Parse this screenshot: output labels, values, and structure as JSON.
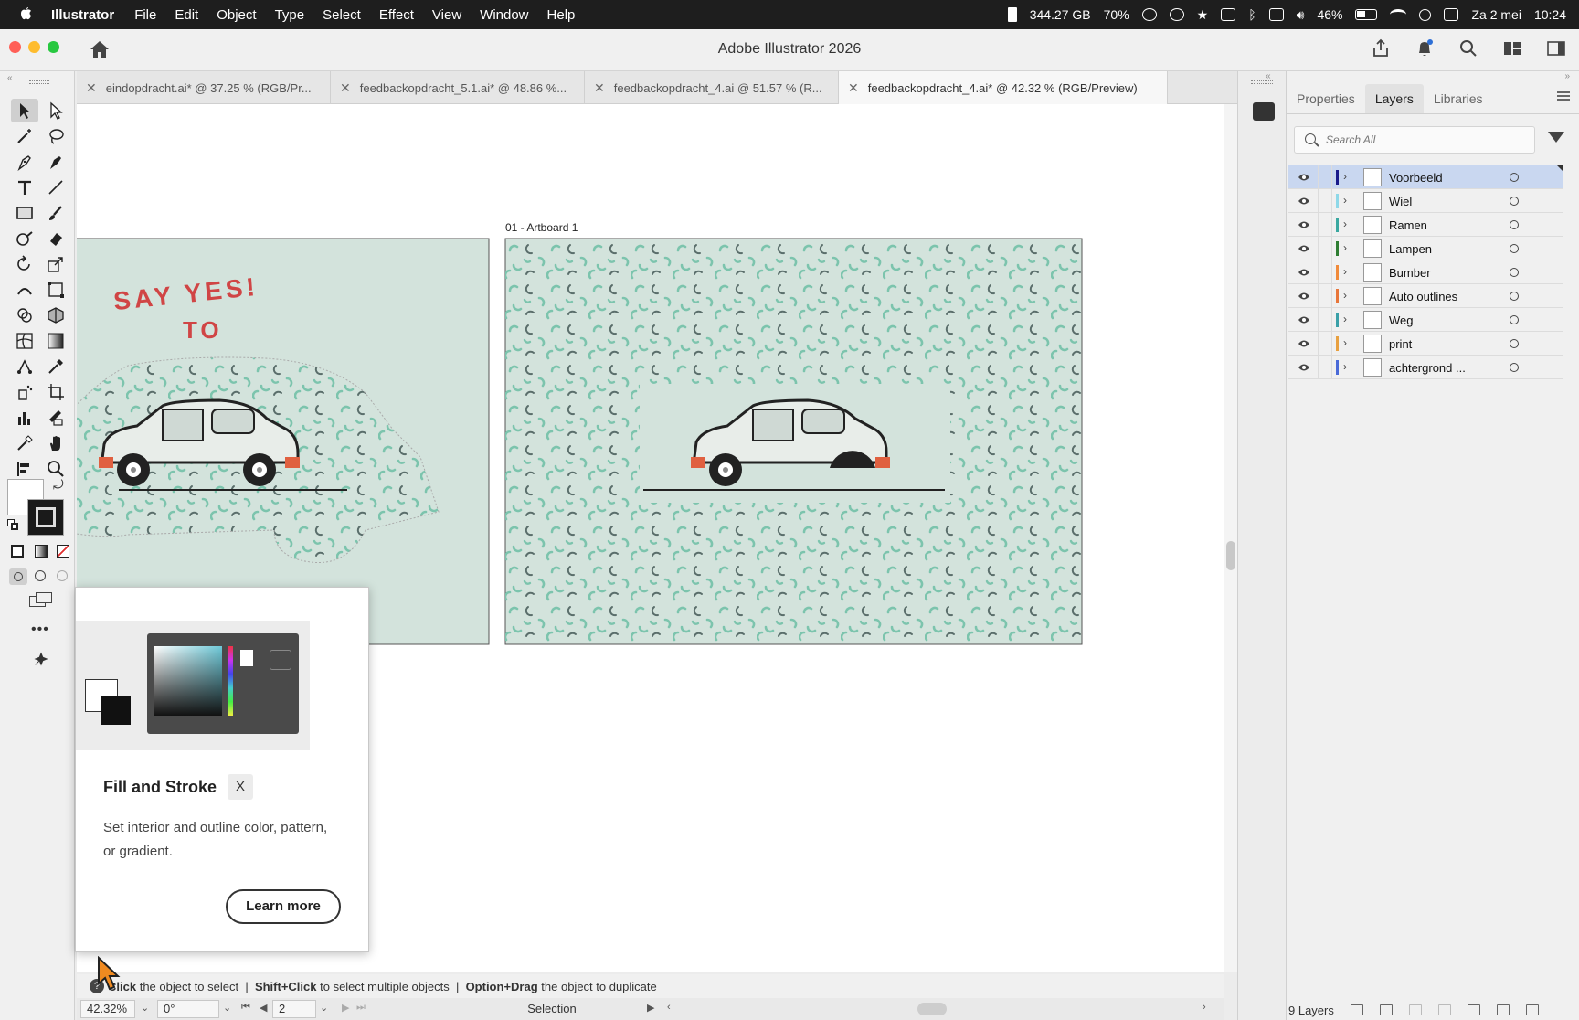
{
  "menubar": {
    "app": "Illustrator",
    "items": [
      "File",
      "Edit",
      "Object",
      "Type",
      "Select",
      "Effect",
      "View",
      "Window",
      "Help"
    ],
    "disk": "344.27 GB",
    "percent": "70%",
    "battery": "46%",
    "date": "Za 2 mei",
    "time": "10:24"
  },
  "window": {
    "title": "Adobe Illustrator 2026"
  },
  "tabs": [
    {
      "label": "eindopdracht.ai* @ 37.25 % (RGB/Pr..."
    },
    {
      "label": "feedbackopdracht_5.1.ai* @ 48.86 %..."
    },
    {
      "label": "feedbackopdracht_4.ai @ 51.57 % (R..."
    },
    {
      "label": "feedbackopdracht_4.ai* @ 42.32 % (RGB/Preview)"
    }
  ],
  "canvas": {
    "artboard_label": "01 - Artboard 1",
    "left_art_text_1": "SAY YES!",
    "left_art_text_2": "TO",
    "bg_color": "#d3e3dc",
    "pattern_colors": [
      "#7cc4ad",
      "#5a6e6b"
    ]
  },
  "right_panel": {
    "tabs": [
      "Properties",
      "Layers",
      "Libraries"
    ],
    "active_tab": "Layers",
    "search_placeholder": "Search All",
    "layers": [
      {
        "name": "Voorbeeld",
        "color": "#1a1a8a",
        "selected": true
      },
      {
        "name": "Wiel",
        "color": "#8ed8e8",
        "selected": false
      },
      {
        "name": "Ramen",
        "color": "#3aa8a0",
        "selected": false
      },
      {
        "name": "Lampen",
        "color": "#2e7d32",
        "selected": false
      },
      {
        "name": "Bumber",
        "color": "#f08a3a",
        "selected": false
      },
      {
        "name": "Auto outlines",
        "color": "#e8763a",
        "selected": false
      },
      {
        "name": "Weg",
        "color": "#3aa0a8",
        "selected": false
      },
      {
        "name": "print",
        "color": "#e8a040",
        "selected": false
      },
      {
        "name": "achtergrond ...",
        "color": "#4a6ad8",
        "selected": false
      }
    ],
    "footer_count": "9 Layers"
  },
  "hint": {
    "b1": "Click",
    "t1": "the object to select",
    "b2": "Shift+Click",
    "t2": "to select multiple objects",
    "b3": "Option+Drag",
    "t3": "the object to duplicate"
  },
  "statusbar": {
    "zoom": "42.32%",
    "rotation": "0°",
    "artboard": "2",
    "tool": "Selection"
  },
  "popup": {
    "title": "Fill and Stroke",
    "shortcut": "X",
    "description": "Set interior and outline color, pattern, or gradient.",
    "button": "Learn more"
  }
}
